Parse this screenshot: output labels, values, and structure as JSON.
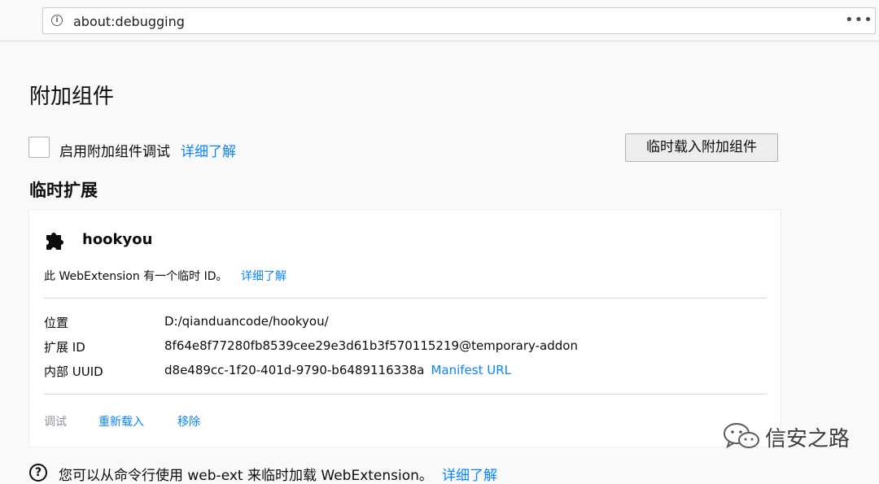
{
  "browser": {
    "url": "about:debugging",
    "page_actions_glyph": "•••",
    "info_glyph": "i"
  },
  "page": {
    "heading": "附加组件",
    "debug_checkbox_label": "启用附加组件调试",
    "debug_learn_more": "详细了解",
    "load_temp_button": "临时载入附加组件",
    "section_title": "临时扩展"
  },
  "extension": {
    "name": "hookyou",
    "icon": "puzzle-piece-icon",
    "temp_note": "此 WebExtension 有一个临时 ID。",
    "temp_learn_more": "详细了解",
    "details": [
      {
        "label": "位置",
        "value": "D:/qianduancode/hookyou/"
      },
      {
        "label": "扩展 ID",
        "value": "8f64e8f77280fb8539cee29e3d61b3f570115219@temporary-addon"
      },
      {
        "label": "内部 UUID",
        "value": "d8e489cc-1f20-401d-9790-b6489116338a",
        "link": "Manifest URL"
      }
    ],
    "actions": {
      "debug": "调试",
      "reload": "重新载入",
      "remove": "移除"
    }
  },
  "footer": {
    "help_glyph": "?",
    "help_text": "您可以从命令行使用 web-ext 来临时加载 WebExtension。",
    "help_link": "详细了解"
  },
  "watermark": {
    "text": "信安之路",
    "icon": "wechat-icon"
  },
  "colors": {
    "link": "#0a84ff",
    "background": "#f9f9fa",
    "card": "#ffffff",
    "disabled": "#8f8f9d"
  }
}
